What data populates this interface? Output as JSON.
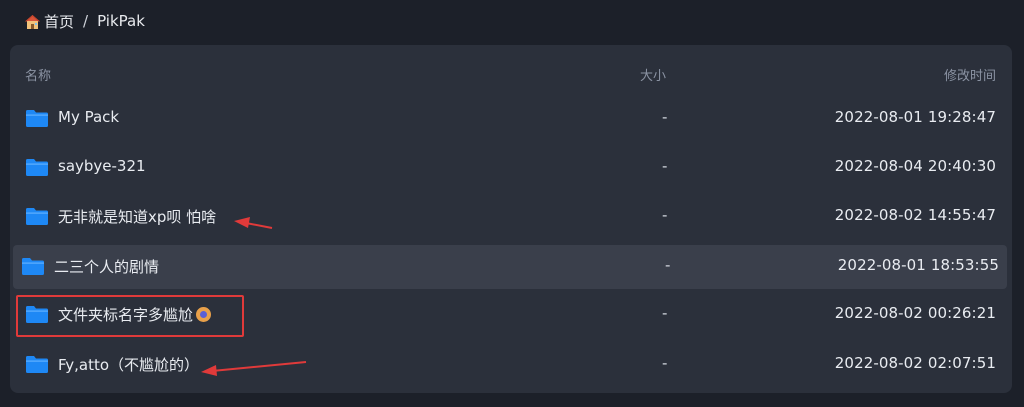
{
  "breadcrumb": {
    "home_label": "首页",
    "separator": "/",
    "current": "PikPak"
  },
  "table": {
    "headers": {
      "name": "名称",
      "size": "大小",
      "time": "修改时间"
    },
    "rows": [
      {
        "name": "My Pack",
        "size": "-",
        "time": "2022-08-01 19:28:47"
      },
      {
        "name": "saybye-321",
        "size": "-",
        "time": "2022-08-04 20:40:30"
      },
      {
        "name": "无非就是知道xp呗 怕啥",
        "size": "-",
        "time": "2022-08-02 14:55:47"
      },
      {
        "name": "二三个人的剧情",
        "size": "-",
        "time": "2022-08-01 18:53:55"
      },
      {
        "name": "文件夹标名字多尴尬",
        "size": "-",
        "time": "2022-08-02 00:26:21"
      },
      {
        "name": "Fy,atto（不尴尬的）",
        "size": "-",
        "time": "2022-08-02 02:07:51"
      }
    ]
  },
  "colors": {
    "background": "#1c2029",
    "panel": "#2b303b",
    "hover_row": "#3a3f4b",
    "folder": "#1e88f5",
    "annotation_red": "#e03a3a"
  },
  "icons": {
    "home": "house-icon",
    "folder": "folder-icon",
    "emoji": "embarrassed-emoji-icon"
  }
}
